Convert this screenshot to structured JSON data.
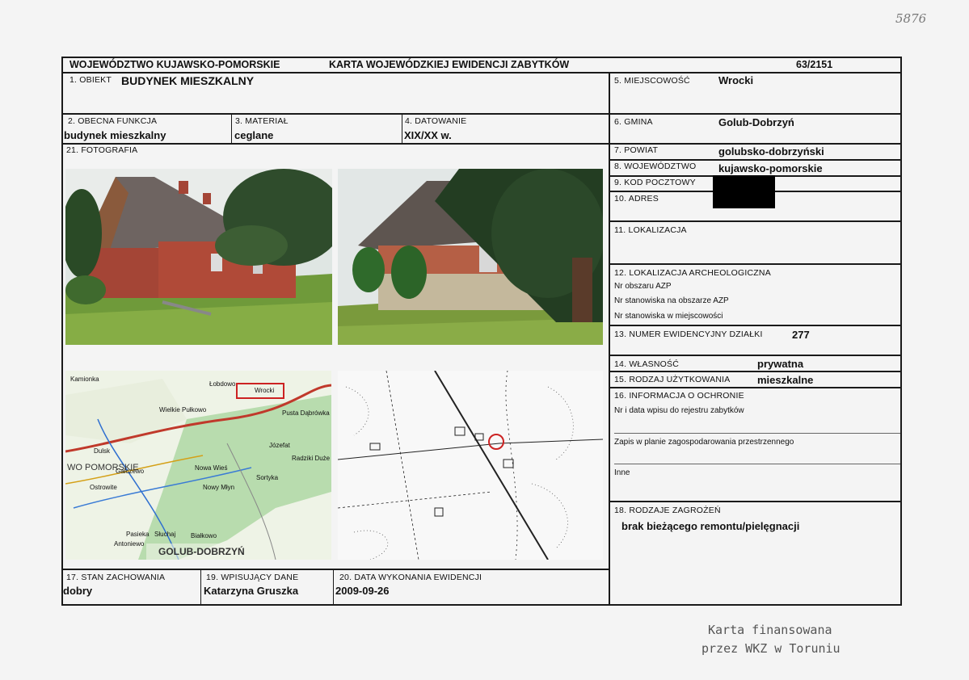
{
  "handwritten_number": "5876",
  "header": {
    "region": "WOJEWÓDZTWO KUJAWSKO-POMORSKIE",
    "title": "KARTA WOJEWÓDZKIEJ EWIDENCJI ZABYTKÓW",
    "number": "63/2151"
  },
  "fields": {
    "f1_label": "1. OBIEKT",
    "f1_value": "BUDYNEK MIESZKALNY",
    "f2_label": "2. OBECNA FUNKCJA",
    "f2_value": "budynek mieszkalny",
    "f3_label": "3. MATERIAŁ",
    "f3_value": "ceglane",
    "f4_label": "4. DATOWANIE",
    "f4_value": "XIX/XX w.",
    "f5_label": "5. MIEJSCOWOŚĆ",
    "f5_value": "Wrocki",
    "f6_label": "6. GMINA",
    "f6_value": "Golub-Dobrzyń",
    "f7_label": "7. POWIAT",
    "f7_value": "golubsko-dobrzyński",
    "f8_label": "8. WOJEWÓDZTWO",
    "f8_value": "kujawsko-pomorskie",
    "f9_label": "9. KOD POCZTOWY",
    "f10_label": "10. ADRES",
    "f11_label": "11. LOKALIZACJA",
    "f12_label": "12. LOKALIZACJA ARCHEOLOGICZNA",
    "f12_line1": "Nr obszaru AZP",
    "f12_line2": "Nr stanowiska na obszarze AZP",
    "f12_line3": "Nr stanowiska w miejscowości",
    "f13_label": "13. NUMER EWIDENCYJNY DZIAŁKI",
    "f13_value": "277",
    "f14_label": "14. WŁASNOŚĆ",
    "f14_value": "prywatna",
    "f15_label": "15. RODZAJ UŻYTKOWANIA",
    "f15_value": "mieszkalne",
    "f16_label": "16. INFORMACJA O OCHRONIE",
    "f16_line1": "Nr i data wpisu do rejestru zabytków",
    "f16_line2": "Zapis w planie zagospodarowania przestrzennego",
    "f16_line3": "Inne",
    "f17_label": "17. STAN ZACHOWANIA",
    "f17_value": "dobry",
    "f18_label": "18. RODZAJE ZAGROŻEŃ",
    "f18_value": "brak bieżącego remontu/pielęgnacji",
    "f19_label": "19. WPISUJĄCY DANE",
    "f19_value": "Katarzyna Gruszka",
    "f20_label": "20. DATA WYKONANIA EWIDENCJI",
    "f20_value": "2009-09-26",
    "f21_label": "21. FOTOGRAFIA"
  },
  "map": {
    "labels": [
      "Wrocki",
      "Łobdowo",
      "Wielkie Pułkowo",
      "Kamionka",
      "Nowy Młyn",
      "Radziki Duże",
      "Dulsk",
      "Ostrowite",
      "Nowa Wieś",
      "Sortyka",
      "Słuchaj",
      "Pusta Dąbrówka",
      "Józefat",
      "Gałczewo",
      "Białkowo",
      "Antoniewo",
      "Pasieka"
    ],
    "region_label": "WO POMORSKIE",
    "town_label": "GOLUB-DOBRZYŃ"
  },
  "footer_stamp": {
    "line1": "Karta finansowana",
    "line2": "przez WKZ w Toruniu"
  },
  "colors": {
    "border": "#1a1a1a",
    "redaction": "#000000",
    "map_marker": "#cc2222"
  }
}
